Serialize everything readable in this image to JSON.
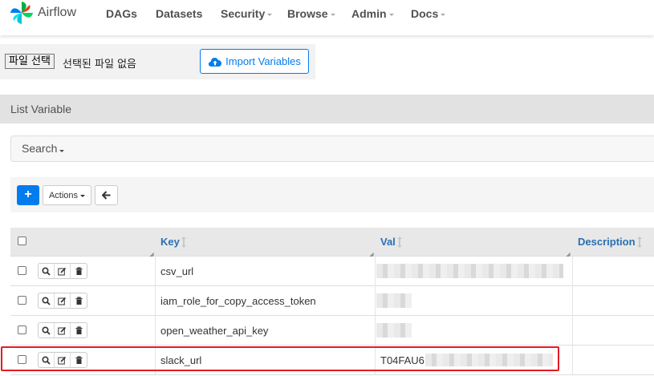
{
  "brand": {
    "name": "Airflow",
    "icon": "airflow-pinwheel-icon"
  },
  "nav": [
    {
      "label": "DAGs",
      "dropdown": false
    },
    {
      "label": "Datasets",
      "dropdown": false
    },
    {
      "label": "Security",
      "dropdown": true
    },
    {
      "label": "Browse",
      "dropdown": true
    },
    {
      "label": "Admin",
      "dropdown": true
    },
    {
      "label": "Docs",
      "dropdown": true
    }
  ],
  "file_input": {
    "button_label": "파일 선택",
    "status": "선택된 파일 없음"
  },
  "import_button": {
    "label": "Import Variables",
    "icon": "cloud-upload-icon"
  },
  "panel_title": "List Variable",
  "search": {
    "label": "Search"
  },
  "toolbar": {
    "add_label": "+",
    "actions_label": "Actions",
    "back_icon": "arrow-left-icon"
  },
  "table": {
    "columns": [
      "Key",
      "Val",
      "Description"
    ],
    "rows": [
      {
        "key": "csv_url",
        "val": ""
      },
      {
        "key": "iam_role_for_copy_access_token",
        "val": ""
      },
      {
        "key": "open_weather_api_key",
        "val": ""
      },
      {
        "key": "slack_url",
        "val": "T04FAU6"
      }
    ]
  },
  "colors": {
    "accent": "#017cee",
    "highlight": "#e31c24",
    "header_link": "#2a6fb3"
  }
}
